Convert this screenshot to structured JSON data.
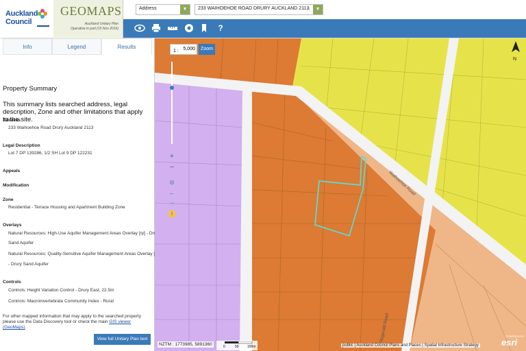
{
  "header": {
    "council_line1": "Auckland",
    "council_line2": "Council",
    "council_tag": "Te Kaunihera o Tāmaki Makaurau",
    "app_title": "GEOMAPS",
    "plan_line1": "Auckland Unitary Plan",
    "plan_line2": "Operative in part (15 Nov 2016)",
    "search_type": "Address",
    "search_value": "233 WAIHOEHOE ROAD DRURY AUCKLAND 2113"
  },
  "toolbar": {
    "icons": [
      "eye-icon",
      "print-icon",
      "measure-icon",
      "geolocate-icon",
      "bookmark-icon",
      "help-icon"
    ],
    "help_glyph": "?"
  },
  "tabs": [
    {
      "label": "Info",
      "active": false
    },
    {
      "label": "Legend",
      "active": false
    },
    {
      "label": "Results",
      "active": true
    }
  ],
  "summary": {
    "title": "Property Summary",
    "description": "This summary lists searched address, legal description, Zone and other limitations that apply to the site.",
    "sections": [
      {
        "label": "Address",
        "values": [
          "233 Waihoehoe Road Drury Auckland 2113"
        ]
      },
      {
        "label": "Legal Description",
        "values": [
          "Lot 7 DP 139286, 1/2 SH Lot 9 DP 122231"
        ]
      },
      {
        "label": "Appeals",
        "values": []
      },
      {
        "label": "Modification",
        "values": []
      },
      {
        "label": "Zone",
        "values": [
          "Residential - Terrace Housing and Apartment Building Zone"
        ]
      },
      {
        "label": "Overlays",
        "values": [
          "Natural Resources: High-Use Aquifer Management Areas Overlay [rp] - Dru",
          "Sand Aquifer",
          "Natural Resources: Quality-Sensitive Aquifer Management Areas Overlay [",
          "- Drury Sand Aquifer"
        ]
      },
      {
        "label": "Controls",
        "values": [
          "Controls: Height Variation Control - Drury East, 22.5m",
          "Controls: Macroinvertebrate Community Index - Rural"
        ]
      }
    ],
    "footer_line1": "For other mapped information that may apply to the searched property",
    "footer_line2": "please use the Data Discovery tool or check the main ",
    "footer_link": "GIS viewer",
    "footer_link2": "(GeoMaps)",
    "footer_end": ".",
    "view_button": "View full Unitary Plan text"
  },
  "map": {
    "scale_prefix": "1 :",
    "scale_value": "5,000",
    "zoom_label": "Zoom",
    "coords": "NZTM : 1773985, 5891360",
    "scale_labels": [
      "0",
      "50",
      "100m"
    ],
    "attribution": "public | Auckland Council Plans and Places | Spatial Infrastructure Strategy",
    "esri": "esri",
    "esri_small": "POWERED BY",
    "north": "N",
    "road_label": "Waihoehoe Road",
    "road_label2": "Fitzgerald Road",
    "colors": {
      "orange": "#dd7a33",
      "yellow": "#e6e34a",
      "purple": "#d3b0ef",
      "peach": "#efb688",
      "road": "#f3f3f3",
      "parcel_line": "#a8672c",
      "highlight": "#5fd9d0"
    }
  }
}
